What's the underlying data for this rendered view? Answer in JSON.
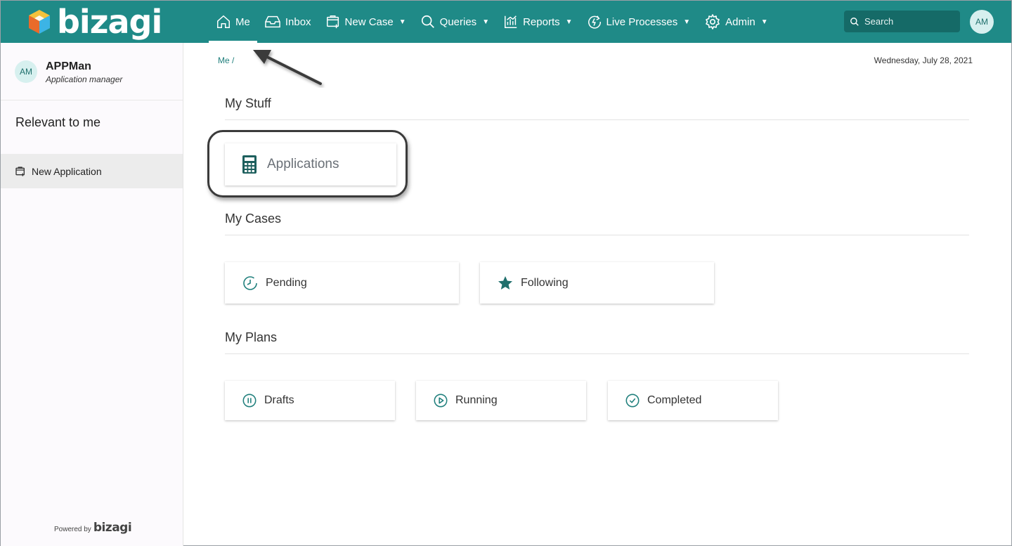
{
  "brand": {
    "name": "bizagi",
    "logo_color": "#ffffff"
  },
  "nav": {
    "items": [
      {
        "key": "me",
        "label": "Me",
        "icon": "home-icon",
        "dropdown": false,
        "active": true
      },
      {
        "key": "inbox",
        "label": "Inbox",
        "icon": "inbox-icon",
        "dropdown": false
      },
      {
        "key": "new-case",
        "label": "New Case",
        "icon": "new-case-icon",
        "dropdown": true
      },
      {
        "key": "queries",
        "label": "Queries",
        "icon": "search-icon",
        "dropdown": true
      },
      {
        "key": "reports",
        "label": "Reports",
        "icon": "chart-icon",
        "dropdown": true
      },
      {
        "key": "live-processes",
        "label": "Live Processes",
        "icon": "live-process-icon",
        "dropdown": true
      },
      {
        "key": "admin",
        "label": "Admin",
        "icon": "gear-icon",
        "dropdown": true
      }
    ],
    "search_placeholder": "Search",
    "avatar_initials": "AM"
  },
  "sidebar": {
    "user": {
      "initials": "AM",
      "name": "APPMan",
      "role": "Application manager"
    },
    "section_title": "Relevant to me",
    "items": [
      {
        "label": "New Application",
        "icon": "new-case-icon"
      }
    ],
    "powered_by": "Powered by",
    "powered_logo": "bizagi"
  },
  "main": {
    "breadcrumb": "Me /",
    "date": "Wednesday, July 28, 2021",
    "sections": {
      "stuff": {
        "title": "My Stuff",
        "cards": [
          {
            "label": "Applications",
            "icon": "calculator-icon"
          }
        ]
      },
      "cases": {
        "title": "My Cases",
        "cards": [
          {
            "label": "Pending",
            "icon": "clock-icon"
          },
          {
            "label": "Following",
            "icon": "star-icon"
          }
        ]
      },
      "plans": {
        "title": "My Plans",
        "cards": [
          {
            "label": "Drafts",
            "icon": "pause-icon"
          },
          {
            "label": "Running",
            "icon": "play-icon"
          },
          {
            "label": "Completed",
            "icon": "check-icon"
          }
        ]
      }
    }
  },
  "colors": {
    "topbar": "#1f8a87",
    "accent": "#1f7f7c",
    "search_bg": "#156a67"
  }
}
